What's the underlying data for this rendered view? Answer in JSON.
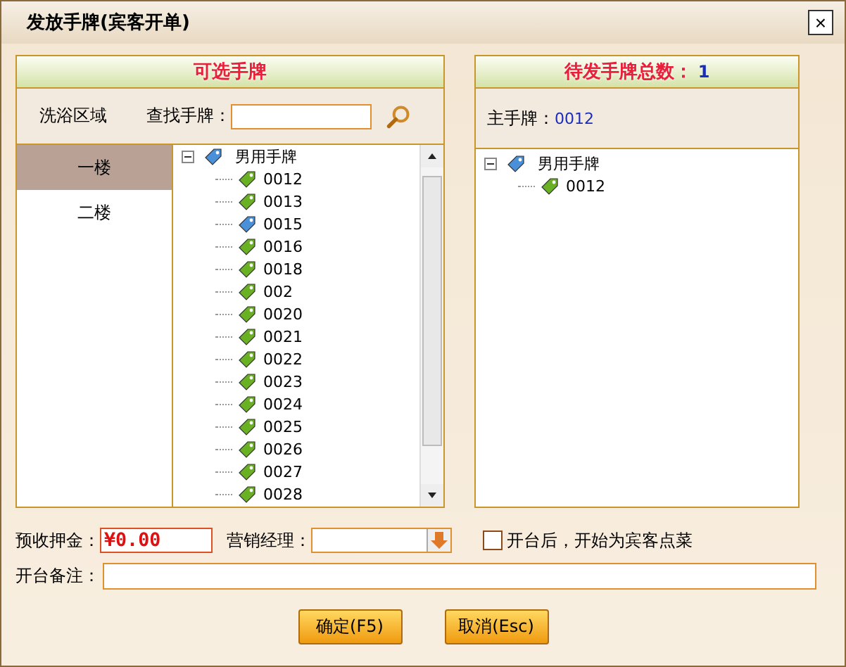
{
  "window": {
    "title": "发放手牌(宾客开单)",
    "close": "×"
  },
  "available": {
    "title": "可选手牌",
    "area_label": "洗浴区域",
    "search_label": "查找手牌：",
    "floors": [
      {
        "label": "一楼",
        "selected": true
      },
      {
        "label": "二楼",
        "selected": false
      }
    ],
    "tree": {
      "label": "男用手牌",
      "expanded": true,
      "color": "#4a90d9",
      "children": [
        {
          "label": "0012",
          "color": "#6ab023"
        },
        {
          "label": "0013",
          "color": "#6ab023"
        },
        {
          "label": "0015",
          "color": "#4a90d9"
        },
        {
          "label": "0016",
          "color": "#6ab023"
        },
        {
          "label": "0018",
          "color": "#6ab023"
        },
        {
          "label": "002",
          "color": "#6ab023"
        },
        {
          "label": "0020",
          "color": "#6ab023"
        },
        {
          "label": "0021",
          "color": "#6ab023"
        },
        {
          "label": "0022",
          "color": "#6ab023"
        },
        {
          "label": "0023",
          "color": "#6ab023"
        },
        {
          "label": "0024",
          "color": "#6ab023"
        },
        {
          "label": "0025",
          "color": "#6ab023"
        },
        {
          "label": "0026",
          "color": "#6ab023"
        },
        {
          "label": "0027",
          "color": "#6ab023"
        },
        {
          "label": "0028",
          "color": "#6ab023"
        }
      ]
    }
  },
  "pending": {
    "title": "待发手牌总数：",
    "count": "1",
    "main_label": "主手牌：",
    "main_value": "0012",
    "tree": {
      "label": "男用手牌",
      "expanded": true,
      "color": "#4a90d9",
      "children": [
        {
          "label": "0012",
          "color": "#6ab023"
        }
      ]
    }
  },
  "deposit": {
    "label": "预收押金：",
    "value": "¥0.00"
  },
  "manager": {
    "label": "营销经理："
  },
  "order_dishes": {
    "label": "开台后，开始为宾客点菜",
    "checked": false
  },
  "remark": {
    "label": "开台备注："
  },
  "buttons": [
    "确定(F5)",
    "取消(Esc)"
  ]
}
